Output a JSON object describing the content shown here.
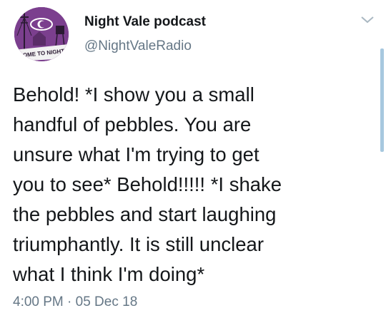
{
  "tweet": {
    "author": {
      "display_name": "Night Vale podcast",
      "handle": "@NightValeRadio",
      "avatar_icon": "night-vale-logo-icon",
      "avatar_caption": "COME TO NIGHT V"
    },
    "text": "Behold! *I show you a small\nhandful of pebbles. You are\nunsure what I'm trying to get\nyou to see* Behold!!!!! *I shake\nthe pebbles and start laughing\ntriumphantly. It is still unclear\nwhat I think I'm doing*",
    "timestamp": "4:00 PM · 05 Dec 18",
    "menu_icon": "chevron-down-icon"
  },
  "colors": {
    "text": "#14171a",
    "secondary": "#657786",
    "avatar_bg": "#7b3f8e",
    "scroll": "#a7c8df"
  }
}
